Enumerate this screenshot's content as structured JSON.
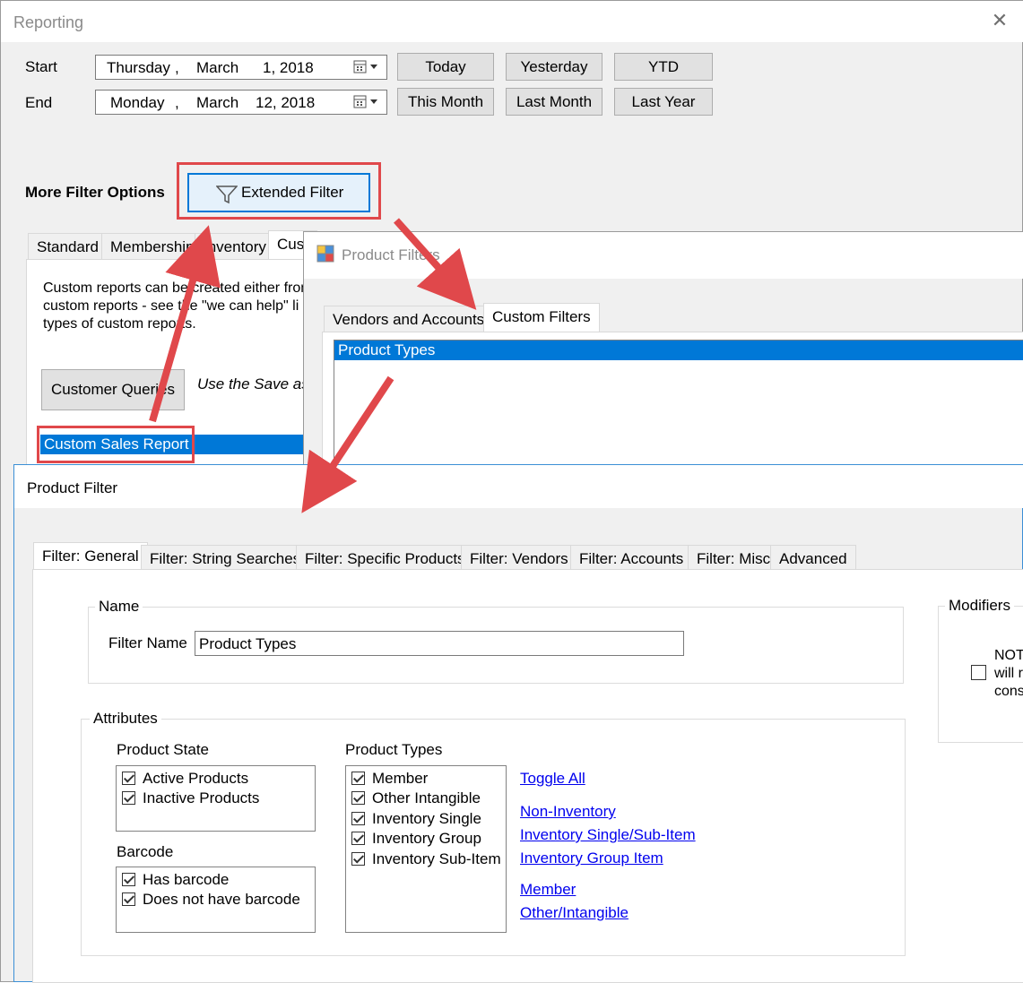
{
  "reporting": {
    "title": "Reporting",
    "start_label": "Start",
    "end_label": "End",
    "start_date": {
      "weekday": "Thursday",
      "comma": ",",
      "month": "March",
      "day_year": "1, 2018"
    },
    "end_date": {
      "weekday": "Monday",
      "comma": ",",
      "month": "March",
      "day_year": "12, 2018"
    },
    "quick_buttons": [
      "Today",
      "Yesterday",
      "YTD",
      "This Month",
      "Last Month",
      "Last Year"
    ],
    "more_filter_label": "More Filter Options",
    "extended_filter_label": "Extended Filter",
    "tabs": [
      "Standard",
      "Membership",
      "Inventory",
      "Cust"
    ],
    "description_lines": [
      "Custom reports can be created either from",
      "custom reports - see the \"we can help\" li",
      "types of custom reports."
    ],
    "customer_queries_label": "Customer Queries",
    "save_hint": "Use the Save as",
    "selected_report": "Custom Sales Report"
  },
  "product_filters": {
    "title": "Product Filters",
    "tabs": [
      "Vendors and Accounts",
      "Custom Filters"
    ],
    "list_selected": "Product Types"
  },
  "product_filter": {
    "title": "Product Filter",
    "tabs": [
      "Filter: General",
      "Filter: String Searches",
      "Filter: Specific Products",
      "Filter: Vendors",
      "Filter: Accounts",
      "Filter: Misc",
      "Advanced"
    ],
    "name_group": "Name",
    "filter_name_label": "Filter Name",
    "filter_name_value": "Product Types",
    "modifiers_group": "Modifiers",
    "modifier_lines": [
      "NOT",
      "will r",
      "cons"
    ],
    "attributes_group": "Attributes",
    "product_state_label": "Product State",
    "product_state_items": [
      {
        "label": "Active Products",
        "checked": true
      },
      {
        "label": "Inactive Products",
        "checked": true
      }
    ],
    "barcode_label": "Barcode",
    "barcode_items": [
      {
        "label": "Has barcode",
        "checked": true
      },
      {
        "label": "Does not have barcode",
        "checked": true
      }
    ],
    "product_types_label": "Product Types",
    "product_types_items": [
      {
        "label": "Member",
        "checked": true
      },
      {
        "label": "Other Intangible",
        "checked": true
      },
      {
        "label": "Inventory Single",
        "checked": true
      },
      {
        "label": "Inventory Group",
        "checked": true
      },
      {
        "label": "Inventory Sub-Item",
        "checked": true
      }
    ],
    "links": [
      "Toggle All",
      "Non-Inventory",
      "Inventory Single/Sub-Item",
      "Inventory Group Item",
      "Member",
      "Other/Intangible"
    ]
  },
  "colors": {
    "accent_red": "#e0484b",
    "selection_blue": "#0078d7",
    "link_blue": "#0000ee"
  }
}
